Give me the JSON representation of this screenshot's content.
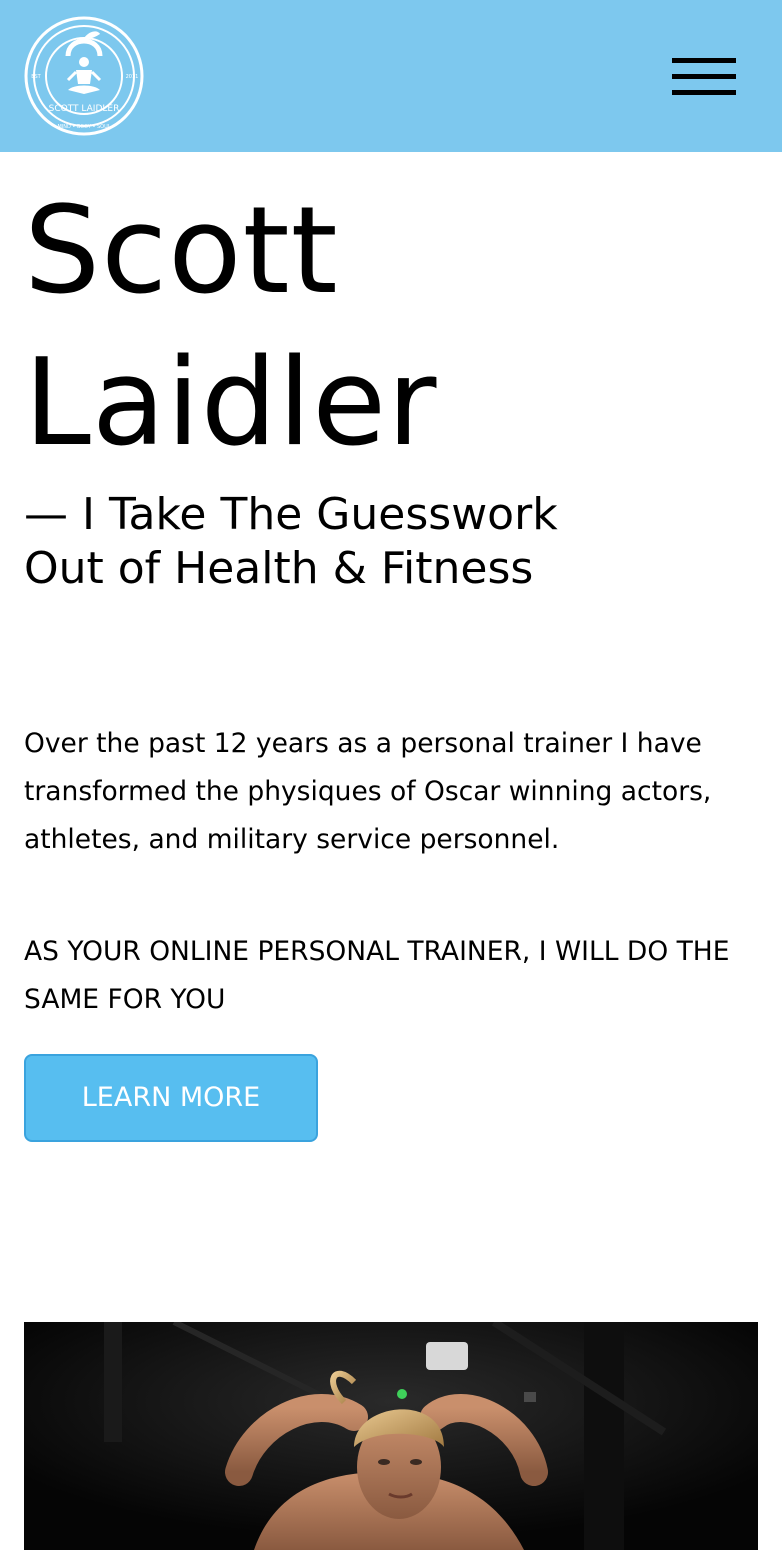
{
  "header": {
    "logo": {
      "icon": "kettlebell-meditation-logo",
      "text": "SCOTT LAIDLER",
      "motto": "MIND • BODY • SOUL",
      "est_left": "EST",
      "est_right": "2011"
    },
    "menu_icon": "hamburger-menu-icon",
    "colors": {
      "background": "#7dc8ee"
    }
  },
  "hero": {
    "title_line1": "Scott",
    "title_line2": "Laidler",
    "tagline_line1": "— I Take The Guesswork",
    "tagline_line2": "Out of Health & Fitness"
  },
  "intro": {
    "paragraph": "Over the past 12 years as a personal trainer I have transformed the physiques of Oscar winning actors, athletes, and military service personnel.",
    "callout": "AS YOUR ONLINE PERSONAL TRAINER, I WILL DO THE SAME FOR YOU",
    "cta_label": "LEARN MORE",
    "cta_color": "#57bef0"
  },
  "media": {
    "image_subject": "woman-training-in-gym-photo"
  }
}
